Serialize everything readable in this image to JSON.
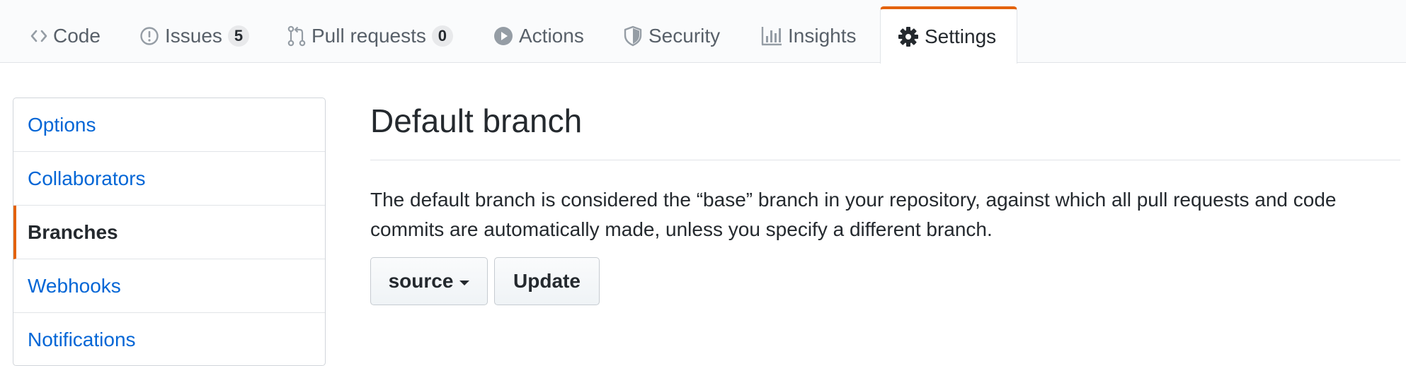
{
  "tabs": [
    {
      "label": "Code",
      "icon": "code-icon"
    },
    {
      "label": "Issues",
      "icon": "issue-opened-icon",
      "counter": "5"
    },
    {
      "label": "Pull requests",
      "icon": "git-pull-request-icon",
      "counter": "0"
    },
    {
      "label": "Actions",
      "icon": "play-icon"
    },
    {
      "label": "Security",
      "icon": "shield-icon"
    },
    {
      "label": "Insights",
      "icon": "graph-icon"
    },
    {
      "label": "Settings",
      "icon": "gear-icon",
      "selected": true
    }
  ],
  "sidebar": {
    "items": [
      {
        "label": "Options"
      },
      {
        "label": "Collaborators"
      },
      {
        "label": "Branches",
        "selected": true
      },
      {
        "label": "Webhooks"
      },
      {
        "label": "Notifications"
      }
    ]
  },
  "main": {
    "heading": "Default branch",
    "description": "The default branch is considered the “base” branch in your repository, against which all pull requests and code commits are automatically made, unless you specify a different branch.",
    "branch_select_label": "source",
    "update_label": "Update"
  },
  "colors": {
    "accent": "#e36209",
    "link": "#0366d6",
    "text": "#24292e",
    "muted": "#586069",
    "border": "#e1e4e8"
  }
}
